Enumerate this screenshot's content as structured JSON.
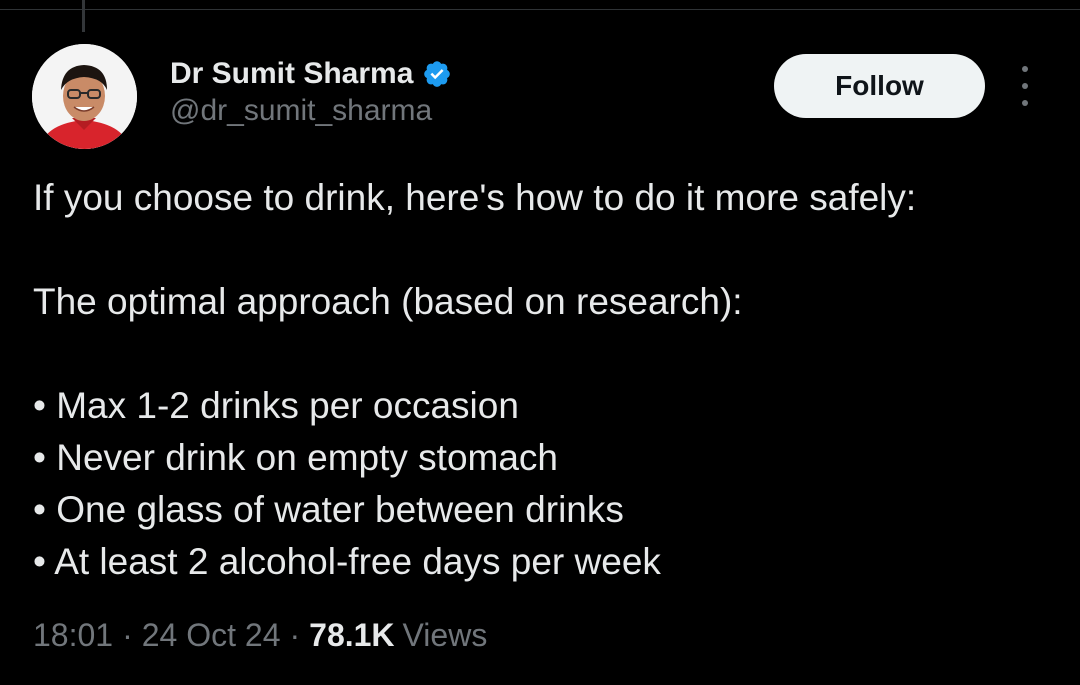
{
  "author": {
    "display_name": "Dr Sumit Sharma",
    "handle": "@dr_sumit_sharma",
    "verified": true,
    "verified_color": "#1d9bf0"
  },
  "actions": {
    "follow_label": "Follow"
  },
  "tweet": {
    "intro": "If you choose to drink, here's how to do it more safely:",
    "subheading": "The optimal approach (based on research):",
    "bullets": [
      "• Max 1-2 drinks per occasion",
      "• Never drink on empty stomach",
      "• One glass of water between drinks",
      "• At least 2 alcohol-free days per week"
    ]
  },
  "meta": {
    "time": "18:01",
    "date": "24 Oct 24",
    "views_count": "78.1K",
    "views_label": "Views",
    "separator": "·"
  },
  "colors": {
    "background": "#000000",
    "text_primary": "#e7e9ea",
    "text_secondary": "#71767b",
    "follow_bg": "#eff3f4"
  }
}
